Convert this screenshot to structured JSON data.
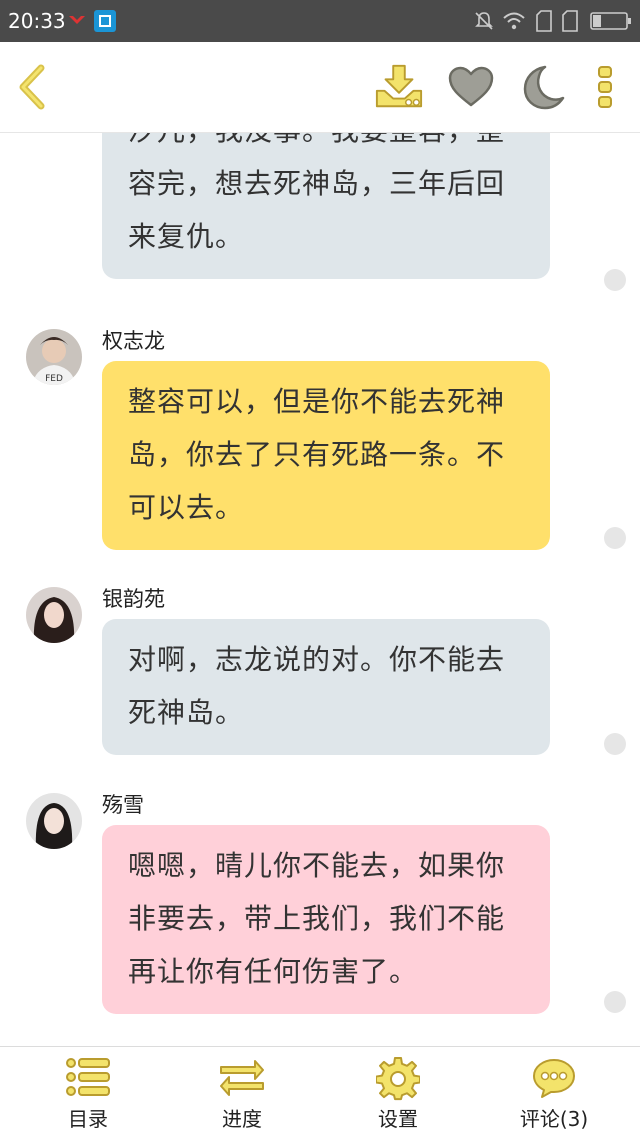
{
  "status_bar": {
    "time": "20:33"
  },
  "toolbar": {
    "icons": [
      "back-icon",
      "download-icon",
      "heart-icon",
      "moon-icon",
      "more-icon"
    ]
  },
  "messages": [
    {
      "name": "",
      "text": "汐儿，我没事。我要整容，整容完，想去死神岛，三年后回来复仇。",
      "color": "#dfe6ea"
    },
    {
      "name": "权志龙",
      "text": "整容可以，但是你不能去死神岛，你去了只有死路一条。不可以去。",
      "color": "#ffe06b"
    },
    {
      "name": "银韵苑",
      "text": "对啊，志龙说的对。你不能去死神岛。",
      "color": "#dfe6ea"
    },
    {
      "name": "殇雪",
      "text": "嗯嗯，晴儿你不能去，如果你非要去，带上我们，我们不能再让你有任何伤害了。",
      "color": "#ffd0d9"
    }
  ],
  "bottom_nav": {
    "items": [
      {
        "label": "目录",
        "icon": "list-icon"
      },
      {
        "label": "进度",
        "icon": "swap-arrows-icon"
      },
      {
        "label": "设置",
        "icon": "gear-icon"
      },
      {
        "label": "评论(3)",
        "icon": "comment-icon"
      }
    ]
  },
  "colors": {
    "accent_yellow": "#ffe06b",
    "icon_outline": "#c8a83a",
    "icon_fill": "#f3e36b",
    "status_bar": "#4a4a4a"
  }
}
